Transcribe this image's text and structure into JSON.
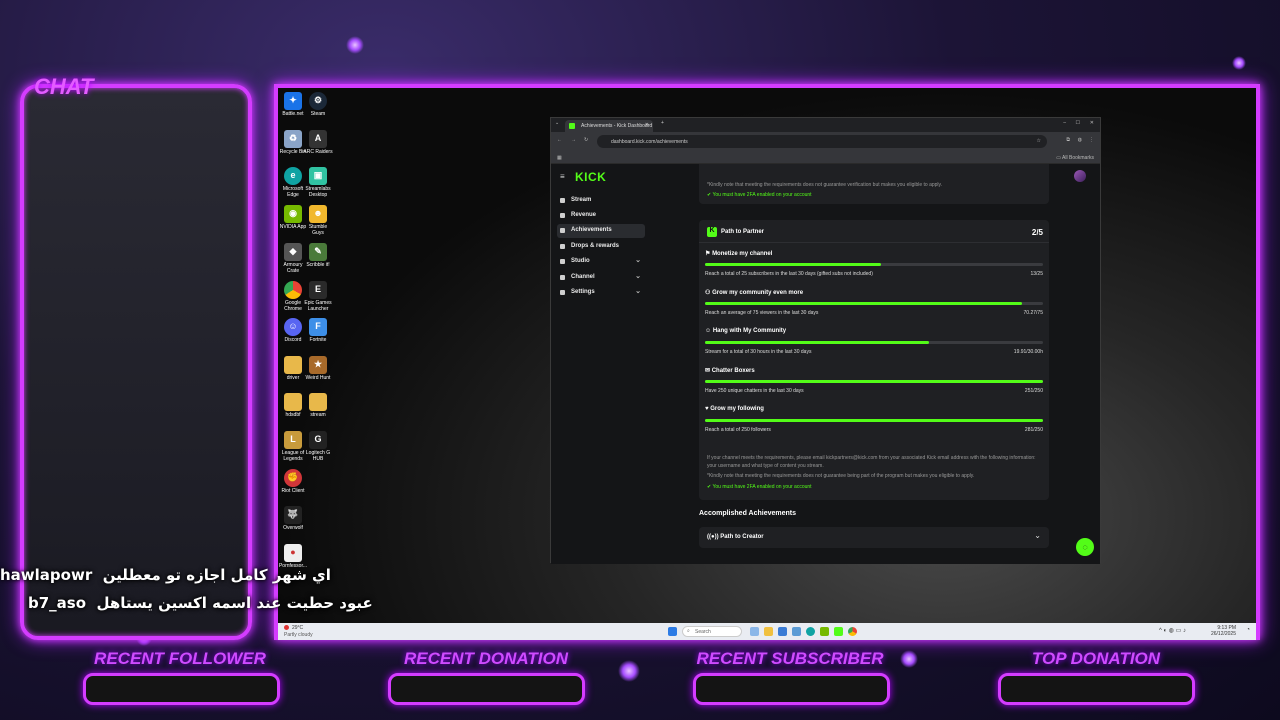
{
  "overlay": {
    "chat_title": "CHAT",
    "chat_messages": [
      {
        "user": "hawlapowr",
        "text": "اي شهر كامل اجازه تو معطلين"
      },
      {
        "user": "b7_aso",
        "text": "عبود حطيت عند اسمه اكسين يستاهل"
      }
    ],
    "bottom_labels": [
      "RECENT FOLLOWER",
      "RECENT DONATION",
      "RECENT SUBSCRIBER",
      "TOP DONATION"
    ],
    "accent_color": "#d43cff"
  },
  "desktop": {
    "icons_col1": [
      "Battle.net",
      "Recycle Bin",
      "Microsoft Edge",
      "NVIDIA App",
      "Armoury Crate",
      "Google Chrome",
      "Discord",
      "driver",
      "hdsdbf",
      "League of Legends",
      "Riot Client",
      "Overwolf",
      "Pornfessor..."
    ],
    "icons_col2": [
      "Steam",
      "ARC Raiders",
      "Streamlabs Desktop",
      "Stumble Guys",
      "Scribble it!",
      "Epic Games Launcher",
      "Fortnite",
      "Weird Hunt",
      "stream",
      "Logitech G HUB"
    ],
    "taskbar": {
      "weather_temp": "29°C",
      "weather_desc": "Partly cloudy",
      "search_placeholder": "Search",
      "time": "9:13 PM",
      "date": "26/12/2025"
    }
  },
  "browser": {
    "tab_title": "Achievements - Kick Dashboard",
    "new_tab": "+",
    "url": "dashboard.kick.com/achievements",
    "all_bookmarks": "All Bookmarks"
  },
  "kick": {
    "logo": "KICK",
    "sidebar": [
      {
        "label": "Stream",
        "expandable": false
      },
      {
        "label": "Revenue",
        "expandable": false
      },
      {
        "label": "Achievements",
        "expandable": false,
        "active": true
      },
      {
        "label": "Drops & rewards",
        "expandable": false
      },
      {
        "label": "Studio",
        "expandable": true
      },
      {
        "label": "Channel",
        "expandable": true
      },
      {
        "label": "Settings",
        "expandable": true
      }
    ],
    "top_note": "*Kindly note that meeting the requirements does not guarantee verification but makes you eligible to apply.",
    "top_2fa": "You must have 2FA enabled on your account",
    "partner": {
      "title": "Path to Partner",
      "progress": "2/5",
      "achievements": [
        {
          "title": "Monetize my channel",
          "desc": "Reach a total of 25 subscribers in the last 30 days (gifted subs not included)",
          "value": "13/25",
          "fraction": 0.52
        },
        {
          "title": "Grow my community even more",
          "desc": "Reach an average of 75 viewers in the last 30 days",
          "value": "70.27/75",
          "fraction": 0.937
        },
        {
          "title": "Hang with My Community",
          "desc": "Stream for a total of 30 hours in the last 30 days",
          "value": "19.91/30.00h",
          "fraction": 0.664
        },
        {
          "title": "Chatter Boxers",
          "desc": "Have 250 unique chatters in the last 30 days",
          "value": "251/250",
          "fraction": 1.0
        },
        {
          "title": "Grow my following",
          "desc": "Reach a total of 250 followers",
          "value": "281/250",
          "fraction": 1.0
        }
      ],
      "info_text": "If your channel meets the requirements, please email kickpartners@kick.com from your associated Kick email address with the following information: your username and what type of content you stream.",
      "note": "*Kindly note that meeting the requirements does not guarantee being part of the program but makes you eligible to apply.",
      "twofa": "You must have 2FA enabled on your account"
    },
    "accomplished_heading": "Accomplished Achievements",
    "accomplished_item": "Path to Creator",
    "brand_color": "#53fc18"
  }
}
